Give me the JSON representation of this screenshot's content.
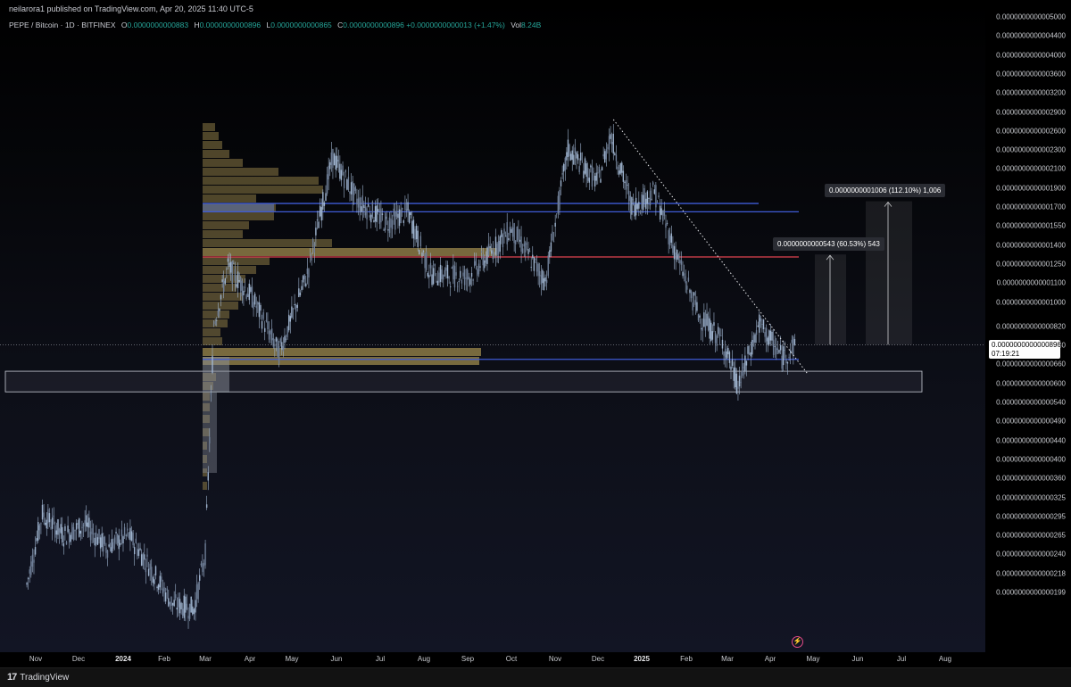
{
  "header": {
    "publish_line": "neilarora1 published on TradingView.com, Apr 20, 2025 11:40 UTC-5",
    "symbol_line": "PEPE / Bitcoin · 1D · BITFINEX",
    "ohlc": {
      "o_label": "O",
      "o_value": "0.0000000000883",
      "h_label": "H",
      "h_value": "0.0000000000896",
      "l_label": "L",
      "l_value": "0.0000000000865",
      "c_label": "C",
      "c_value": "0.0000000000896",
      "change": "+0.0000000000013 (+1.47%)",
      "vol_label": "Vol",
      "vol_value": "8.24B"
    }
  },
  "price_axis": {
    "labels": [
      "0.0000000000005000",
      "0.0000000000004400",
      "0.0000000000004000",
      "0.0000000000003600",
      "0.0000000000003200",
      "0.0000000000002900",
      "0.0000000000002600",
      "0.0000000000002300",
      "0.0000000000002100",
      "0.0000000000001900",
      "0.0000000000001700",
      "0.0000000000001550",
      "0.0000000000001400",
      "0.0000000000001250",
      "0.0000000000001100",
      "0.0000000000001000",
      "0.0000000000000820",
      "0.0000000000000740",
      "0.0000000000000660",
      "0.0000000000000600",
      "0.0000000000000540",
      "0.0000000000000490",
      "0.0000000000000440",
      "0.0000000000000400",
      "0.0000000000000360",
      "0.0000000000000325",
      "0.0000000000000295",
      "0.0000000000000265",
      "0.0000000000000240",
      "0.0000000000000218",
      "0.0000000000000199"
    ],
    "current_price": "0.0000000000000896",
    "countdown": "07:19:21"
  },
  "time_axis": {
    "labels": [
      "Nov",
      "Dec",
      "2024",
      "Feb",
      "Mar",
      "Apr",
      "May",
      "Jun",
      "Jul",
      "Aug",
      "Sep",
      "Oct",
      "Nov",
      "Dec",
      "2025",
      "Feb",
      "Mar",
      "Apr",
      "May",
      "Jun",
      "Jul",
      "Aug"
    ]
  },
  "measures": {
    "short": "0.0000000000543 (60.53%) 543",
    "long": "0.0000000001006 (112.10%) 1,006"
  },
  "footer": {
    "brand": "TradingView",
    "brand_mark": "17"
  },
  "colors": {
    "candle": "#9fb4cf",
    "level_blue": "#3f5bd6",
    "level_red": "#e0434f",
    "volume_profile": "#8c7a45",
    "accent_up": "#26a69a"
  },
  "chart_data": {
    "type": "candlestick",
    "title": "PEPE / Bitcoin · 1D · BITFINEX",
    "y_scale": "log",
    "ylim": [
      1.9e-14,
      5e-14
    ],
    "close_series": [
      [
        "2023-10-25",
        2.55e-14
      ],
      [
        "2023-11-05",
        3.7e-14
      ],
      [
        "2023-11-20",
        3.3e-14
      ],
      [
        "2023-12-05",
        3.5e-14
      ],
      [
        "2023-12-20",
        3.1e-14
      ],
      [
        "2024-01-05",
        3.3e-14
      ],
      [
        "2024-01-20",
        2.8e-14
      ],
      [
        "2024-02-05",
        2.3e-14
      ],
      [
        "2024-02-20",
        2.25e-14
      ],
      [
        "2024-02-28",
        3e-14
      ],
      [
        "2024-03-05",
        1e-13
      ],
      [
        "2024-03-15",
        1.35e-13
      ],
      [
        "2024-04-01",
        1.15e-13
      ],
      [
        "2024-04-20",
        8.6e-14
      ],
      [
        "2024-05-10",
        1.3e-13
      ],
      [
        "2024-05-28",
        2.4e-13
      ],
      [
        "2024-06-15",
        1.9e-13
      ],
      [
        "2024-07-05",
        1.7e-13
      ],
      [
        "2024-07-20",
        1.8e-13
      ],
      [
        "2024-08-05",
        1.3e-13
      ],
      [
        "2024-09-01",
        1.28e-13
      ],
      [
        "2024-10-01",
        1.65e-13
      ],
      [
        "2024-10-25",
        1.25e-13
      ],
      [
        "2024-11-10",
        2.5e-13
      ],
      [
        "2024-12-01",
        2.1e-13
      ],
      [
        "2024-12-10",
        2.7e-13
      ],
      [
        "2024-12-25",
        1.85e-13
      ],
      [
        "2025-01-10",
        2e-13
      ],
      [
        "2025-01-25",
        1.45e-13
      ],
      [
        "2025-02-10",
        1.05e-13
      ],
      [
        "2025-02-28",
        9e-14
      ],
      [
        "2025-03-10",
        7.2e-14
      ],
      [
        "2025-03-25",
        1e-13
      ],
      [
        "2025-04-10",
        8.4e-14
      ],
      [
        "2025-04-20",
        8.96e-14
      ]
    ],
    "horizontal_levels": [
      {
        "price": 1.88e-13,
        "color": "blue"
      },
      {
        "price": 1.8e-13,
        "color": "blue"
      },
      {
        "price": 1.42e-13,
        "color": "red"
      },
      {
        "price": 8.3e-14,
        "color": "blue"
      }
    ],
    "zone": {
      "from": 7e-14,
      "to": 7.8e-14
    },
    "trendline": {
      "from": [
        "2024-12-12",
        2.92e-13
      ],
      "to": [
        "2025-04-28",
        7.7e-14
      ]
    },
    "grid": false,
    "legend": "top-left"
  }
}
